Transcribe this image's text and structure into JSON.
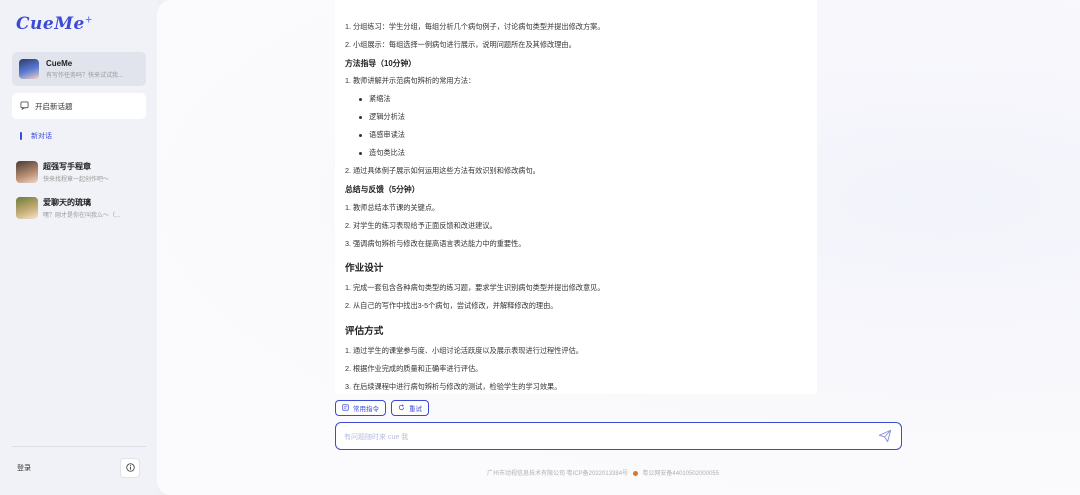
{
  "sidebar": {
    "logo": "CueMe",
    "logo_mark": "+",
    "agent": {
      "name": "CueMe",
      "subtitle": "有写作任务吗？快来试试我..."
    },
    "new_topic": "开启新话题",
    "new_chat": "新对话",
    "history": [
      {
        "title": "超强写手程章",
        "subtitle": "快来找程章一起创作吧～"
      },
      {
        "title": "爱聊天的琉璃",
        "subtitle": "嘿？刚才是你在叫我么～（..."
      }
    ],
    "login": "登录",
    "info_icon": "info-icon"
  },
  "content": {
    "lines": [
      {
        "kind": "text",
        "text": "1. 分组练习：学生分组，每组分析几个病句例子，讨论病句类型并提出修改方案。"
      },
      {
        "kind": "text",
        "text": "2. 小组展示：每组选择一例病句进行展示，说明问题所在及其修改理由。"
      },
      {
        "kind": "sub",
        "text": "方法指导（10分钟）"
      },
      {
        "kind": "text",
        "text": "1. 教师讲解并示范病句辨析的常用方法："
      },
      {
        "kind": "bullet",
        "text": "紧缩法"
      },
      {
        "kind": "bullet",
        "text": "逻辑分析法"
      },
      {
        "kind": "bullet",
        "text": "语感审读法"
      },
      {
        "kind": "bullet",
        "text": "造句类比法"
      },
      {
        "kind": "text",
        "text": "2. 通过具体例子展示如何运用这些方法有效识别和修改病句。"
      },
      {
        "kind": "sub",
        "text": "总结与反馈（5分钟）"
      },
      {
        "kind": "text",
        "text": "1. 教师总结本节课的关键点。"
      },
      {
        "kind": "text",
        "text": "2. 对学生的练习表现给予正面反馈和改进建议。"
      },
      {
        "kind": "text",
        "text": "3. 强调病句辨析与修改在提高语言表达能力中的重要性。"
      },
      {
        "kind": "h2",
        "text": "作业设计"
      },
      {
        "kind": "text",
        "text": "1. 完成一套包含各种病句类型的练习题，要求学生识别病句类型并提出修改意见。"
      },
      {
        "kind": "text",
        "text": "2. 从自己的写作中找出3-5个病句，尝试修改，并解释修改的理由。"
      },
      {
        "kind": "h2",
        "text": "评估方式"
      },
      {
        "kind": "text",
        "text": "1. 通过学生的课堂参与度、小组讨论活跃度以及展示表现进行过程性评估。"
      },
      {
        "kind": "text",
        "text": "2. 根据作业完成的质量和正确率进行评估。"
      },
      {
        "kind": "text",
        "text": "3. 在后续课程中进行病句辨析与修改的测试，检验学生的学习效果。"
      }
    ]
  },
  "actions": {
    "common_commands": "常用指令",
    "retry": "重试"
  },
  "input": {
    "placeholder": "有问题随时来 cue 我",
    "send_icon": "send-icon"
  },
  "footer": {
    "company": "广州市动视信息技术有限公司 粤ICP备2022013384号",
    "police": "粤公网安备44010502000055"
  },
  "colors": {
    "accent": "#3c4bd6"
  }
}
